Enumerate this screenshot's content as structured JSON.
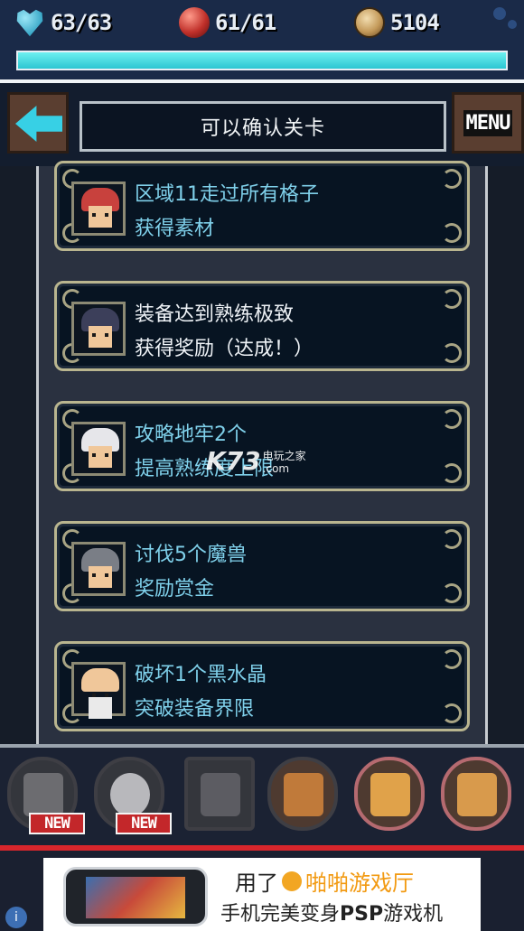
{
  "status": {
    "hp": "63/63",
    "mp": "61/61",
    "coins": "5104",
    "hp_fill_fraction": 1.0,
    "icons": [
      "heart-gem-icon",
      "red-orb-icon",
      "coin-icon"
    ]
  },
  "header": {
    "title": "可以确认关卡",
    "menu_label": "MENU",
    "back_icon": "arrow-left-icon"
  },
  "quests": [
    {
      "line1": "区域11走过所有格子",
      "line2": "获得素材",
      "portrait": "red-hair-girl"
    },
    {
      "line1": "装备达到熟练极致",
      "line2": "获得奖励（达成！）",
      "portrait": "dark-hood"
    },
    {
      "line1": "攻略地牢2个",
      "line2": "提高熟练度上限",
      "portrait": "white-hair"
    },
    {
      "line1": "讨伐5个魔兽",
      "line2": "奖励赏金",
      "portrait": "helmet-knight"
    },
    {
      "line1": "破坏1个黑水晶",
      "line2": "突破装备界限",
      "portrait": "bald-elder"
    }
  ],
  "watermark": {
    "big": "K73",
    "small1": "电玩之家",
    "small2": ".com"
  },
  "items": {
    "new_badge": "NEW",
    "slots": [
      "crossed-weapons-icon",
      "ghost-icon",
      "moon-icon",
      "axe-icon",
      "armor-icon",
      "hat-icon"
    ]
  },
  "ad": {
    "line1_prefix": "用了",
    "line1_brand": "啪啪游戏厅",
    "line2_a": "手机完美变身",
    "line2_b": "PSP",
    "line2_c": "游戏机",
    "info": "i"
  },
  "colors": {
    "accent_cyan": "#37d0e5",
    "quest_text": "#7fd0ea",
    "badge_red": "#c3272a",
    "brand_orange": "#f29a12"
  }
}
